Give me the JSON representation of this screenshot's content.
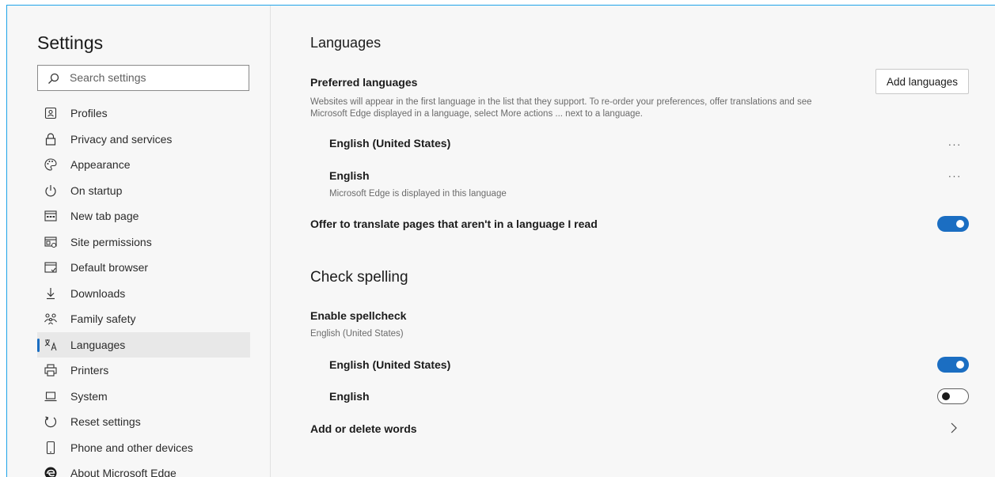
{
  "sidebar": {
    "title": "Settings",
    "search_placeholder": "Search settings",
    "items": [
      {
        "label": "Profiles",
        "icon": "profile-icon"
      },
      {
        "label": "Privacy and services",
        "icon": "lock-icon"
      },
      {
        "label": "Appearance",
        "icon": "palette-icon"
      },
      {
        "label": "On startup",
        "icon": "power-icon"
      },
      {
        "label": "New tab page",
        "icon": "new-tab-icon"
      },
      {
        "label": "Site permissions",
        "icon": "site-permissions-icon"
      },
      {
        "label": "Default browser",
        "icon": "browser-icon"
      },
      {
        "label": "Downloads",
        "icon": "download-icon"
      },
      {
        "label": "Family safety",
        "icon": "family-icon"
      },
      {
        "label": "Languages",
        "icon": "languages-icon",
        "active": true
      },
      {
        "label": "Printers",
        "icon": "printer-icon"
      },
      {
        "label": "System",
        "icon": "laptop-icon"
      },
      {
        "label": "Reset settings",
        "icon": "reset-icon"
      },
      {
        "label": "Phone and other devices",
        "icon": "phone-icon"
      },
      {
        "label": "About Microsoft Edge",
        "icon": "edge-icon"
      }
    ]
  },
  "main": {
    "languages_title": "Languages",
    "preferred": {
      "label": "Preferred languages",
      "description_line1": "Websites will appear in the first language in the list that they support. To re-order your preferences, offer translations and see",
      "description_line2": "Microsoft Edge displayed in a language, select More actions ... next to a language.",
      "add_button": "Add languages",
      "languages": [
        {
          "name": "English (United States)",
          "more": "···"
        },
        {
          "name": "English",
          "note": "Microsoft Edge is displayed in this language",
          "more": "···"
        }
      ]
    },
    "translate": {
      "label": "Offer to translate pages that aren't in a language I read",
      "enabled": true
    },
    "spelling_title": "Check spelling",
    "spellcheck": {
      "label": "Enable spellcheck",
      "sublabel": "English (United States)",
      "languages": [
        {
          "name": "English (United States)",
          "enabled": true
        },
        {
          "name": "English",
          "enabled": false
        }
      ]
    },
    "words": {
      "label": "Add or delete words",
      "icon": "chevron-right-icon"
    }
  },
  "colors": {
    "accent": "#1b6ec2",
    "window_border": "#1fa3e8",
    "background": "#f7f7f7"
  }
}
